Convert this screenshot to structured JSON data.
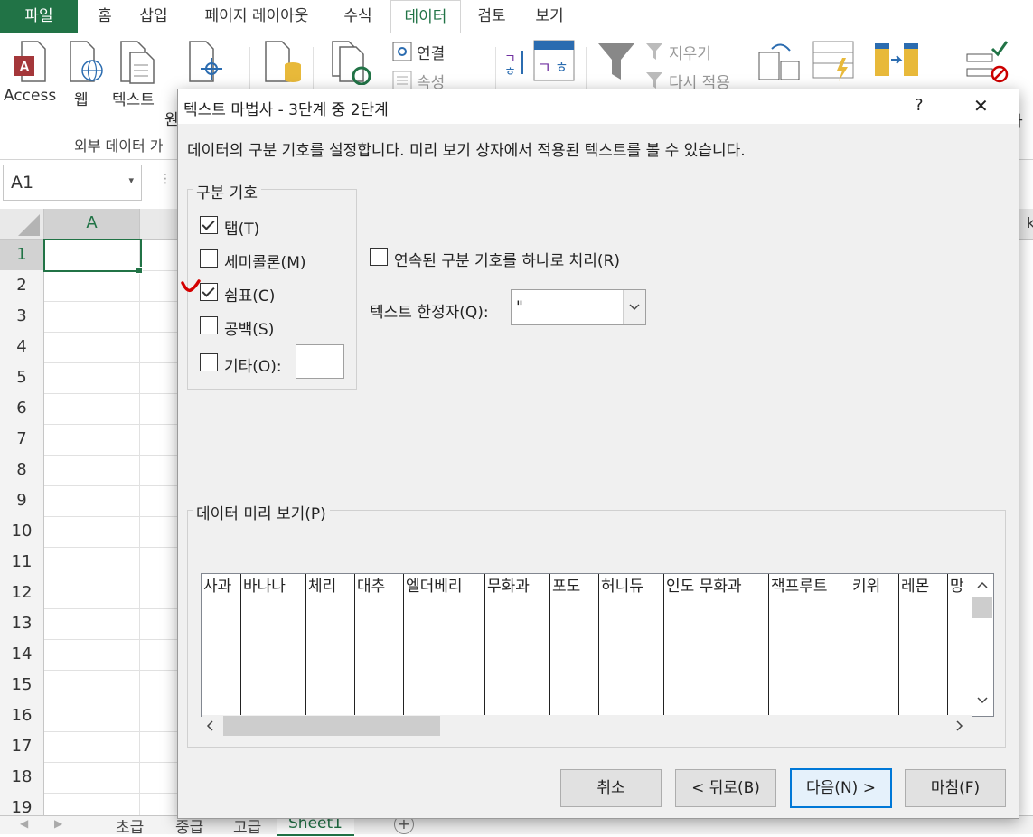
{
  "ribbon_tabs": [
    "파일",
    "홈",
    "삽입",
    "페이지 레이아웃",
    "수식",
    "데이터",
    "검토",
    "보기"
  ],
  "ribbon": {
    "access": "Access",
    "web": "웹",
    "text": "텍스트",
    "other_partial": "원",
    "connections": "연결",
    "properties": "속성",
    "clear": "지우기",
    "reapply": "다시 적용",
    "group_label": "외부 데이터 가",
    "right_partial": "사"
  },
  "formula_bar": {
    "name_box": "A1"
  },
  "sheet": {
    "column_a": "A",
    "column_k_partial": "k",
    "rows": [
      "1",
      "2",
      "3",
      "4",
      "5",
      "6",
      "7",
      "8",
      "9",
      "10",
      "11",
      "12",
      "13",
      "14",
      "15",
      "16",
      "17",
      "18",
      "19"
    ]
  },
  "sheet_tabs": [
    "초급",
    "중급",
    "고급",
    "Sheet1"
  ],
  "dialog": {
    "title": "텍스트 마법사 - 3단계 중 2단계",
    "help": "?",
    "close": "✕",
    "instruction": "데이터의 구분 기호를 설정합니다. 미리 보기 상자에서 적용된 텍스트를 볼 수 있습니다.",
    "delimiters_group": "구분 기호",
    "delimiters": [
      {
        "label": "탭(T)",
        "checked": true
      },
      {
        "label": "세미콜론(M)",
        "checked": false
      },
      {
        "label": "쉼표(C)",
        "checked": true
      },
      {
        "label": "공백(S)",
        "checked": false
      },
      {
        "label": "기타(O):",
        "checked": false
      }
    ],
    "other_value": "",
    "consecutive_label": "연속된 구분 기호를 하나로 처리(R)",
    "consecutive_checked": false,
    "qualifier_label": "텍스트 한정자(Q):",
    "qualifier_value": "\"",
    "preview_label": "데이터 미리 보기(P)",
    "preview_columns": [
      "사과",
      "바나나",
      "체리",
      "대추",
      "엘더베리",
      "무화과",
      "포도",
      "허니듀",
      "인도 무화과",
      "잭프루트",
      "키위",
      "레몬",
      "망"
    ],
    "buttons": {
      "cancel": "취소",
      "back": "< 뒤로(B)",
      "next": "다음(N) >",
      "finish": "마침(F)"
    }
  }
}
